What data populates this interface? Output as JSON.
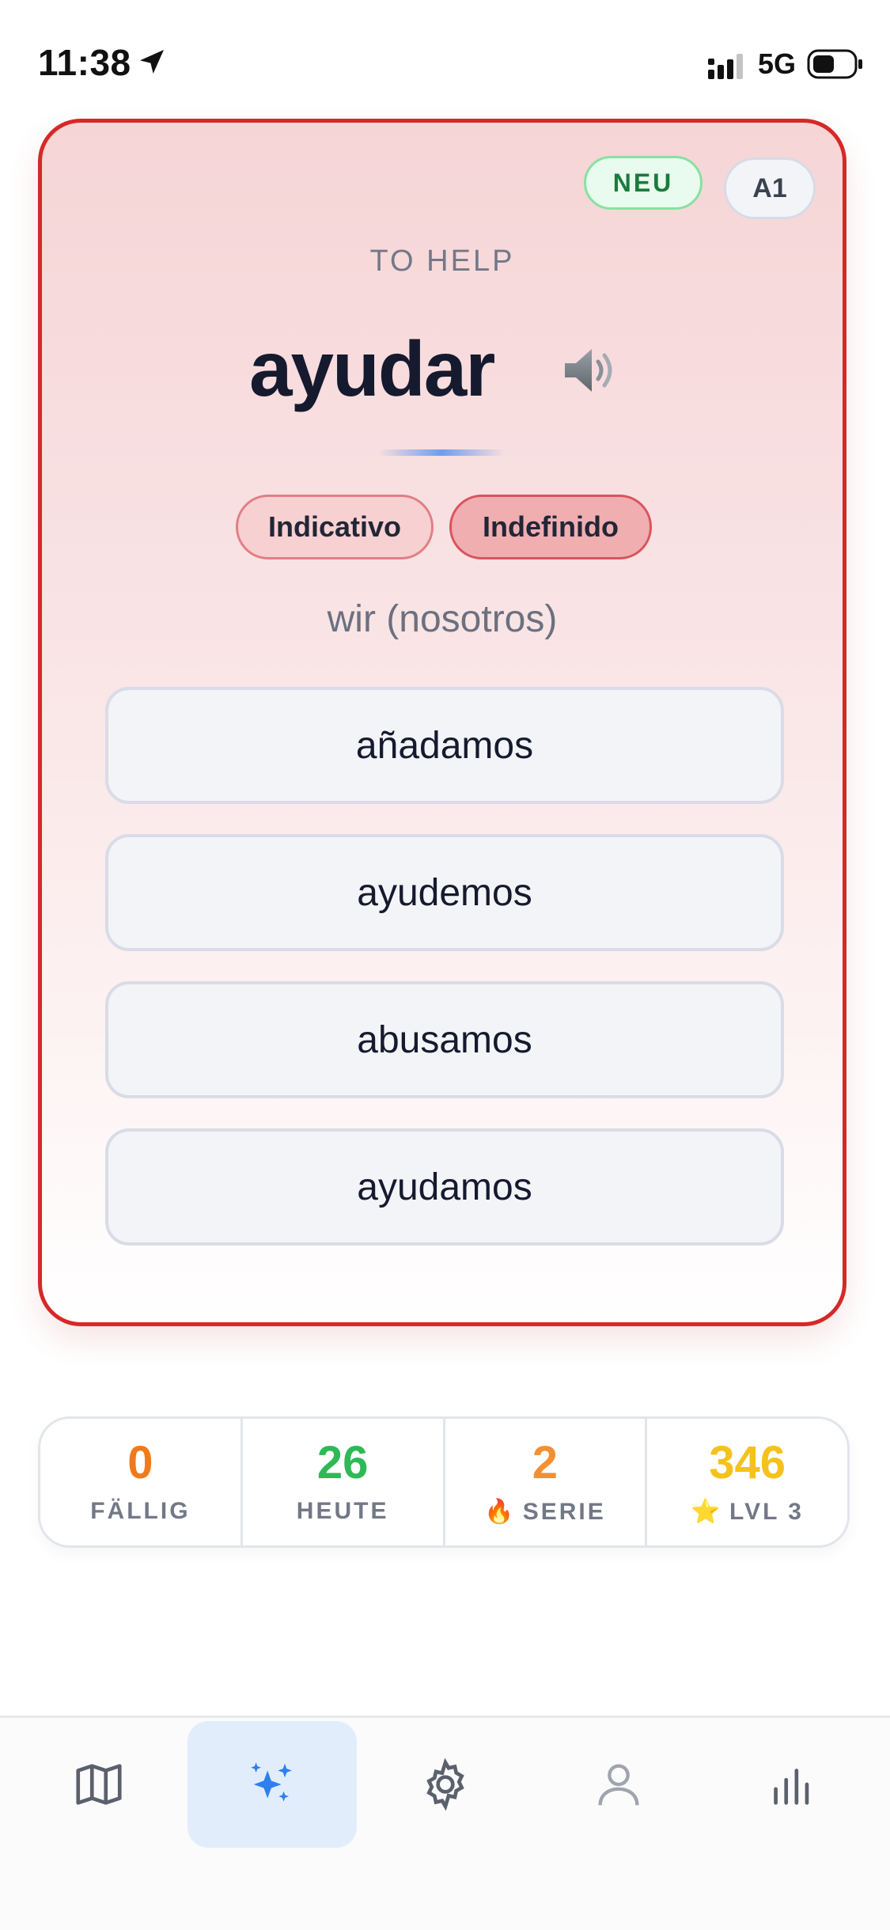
{
  "status_bar": {
    "time": "11:38",
    "network": "5G",
    "icons": [
      "location-arrow-icon",
      "signal-icon",
      "battery-icon"
    ]
  },
  "card": {
    "accent_color": "#d62828",
    "badge_new": "NEU",
    "badge_level": "A1",
    "translation": "TO HELP",
    "verb": "ayudar",
    "speaker_icon": "speaker-icon",
    "mood": "Indicativo",
    "tense": "Indefinido",
    "pronoun": "wir (nosotros)",
    "options": [
      "añadamos",
      "ayudemos",
      "abusamos",
      "ayudamos"
    ]
  },
  "stats": [
    {
      "value": "0",
      "label": "FÄLLIG",
      "color": "#f07a1a"
    },
    {
      "value": "26",
      "label": "HEUTE",
      "color": "#2fb956"
    },
    {
      "value": "2",
      "label": "SERIE",
      "icon": "🔥",
      "color": "#f39032"
    },
    {
      "value": "346",
      "label": "LVL 3",
      "icon": "⭐",
      "color": "#f5c21b"
    }
  ],
  "tabbar": {
    "active_color": "#2f7fec",
    "tabs": [
      {
        "icon": "map-icon",
        "active": false
      },
      {
        "icon": "sparkles-icon",
        "active": true
      },
      {
        "icon": "gear-icon",
        "active": false
      },
      {
        "icon": "person-icon",
        "active": false
      },
      {
        "icon": "bar-chart-icon",
        "active": false
      }
    ]
  }
}
